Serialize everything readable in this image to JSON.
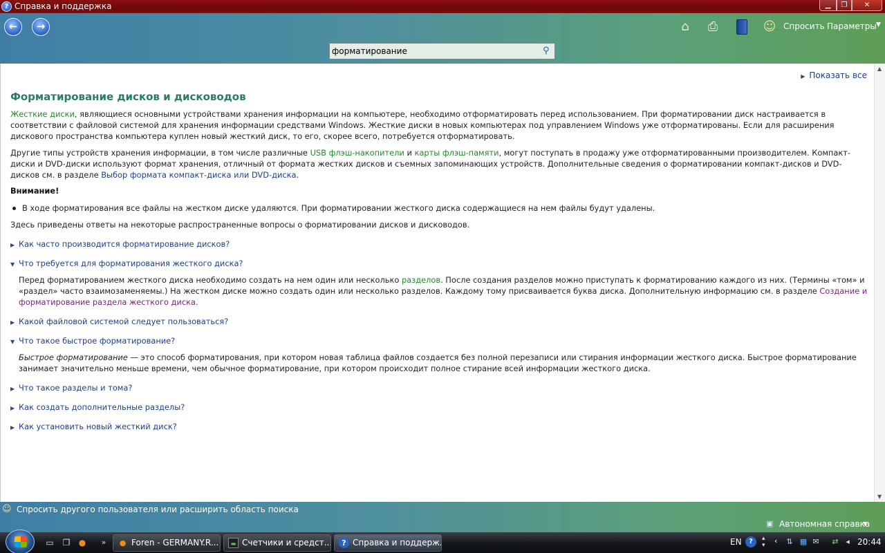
{
  "window": {
    "title": "Справка и поддержка",
    "buttons": {
      "minimize": "▁",
      "maximize": "❐",
      "close": "✕"
    }
  },
  "toolbar": {
    "back": "←",
    "forward": "→",
    "icons": [
      "home-icon",
      "print-icon",
      "book-icon",
      "people-icon"
    ],
    "ask": "Спросить",
    "options": "Параметры",
    "search_value": "форматирование"
  },
  "article": {
    "show_all": "Показать все",
    "title": "Форматирование дисков и дисководов",
    "p1": {
      "link": "Жесткие диски",
      "text": ", являющиеся основными устройствами хранения информации на компьютере, необходимо отформатировать перед использованием. При форматировании диск настраивается в соответствии с файловой системой для хранения информации средствами Windows. Жесткие диски в новых компьютерах под управлением Windows уже отформатированы. Если для расширения дискового пространства компьютера куплен новый жесткий диск, то его, скорее всего, потребуется отформатировать."
    },
    "p2": {
      "t1": "Другие типы устройств хранения информации, в том числе различные ",
      "link1": "USB флэш-накопители",
      "t2": " и ",
      "link2": "карты флэш-памяти",
      "t3": ", могут поступать в продажу уже отформатированными производителем. Компакт-диски и DVD-диски используют формат хранения, отличный от формата жестких дисков и съемных запоминающих устройств. Дополнительные сведения о форматировании компакт-дисков и DVD-дисков см. в разделе ",
      "link3": "Выбор формата компакт-диска или DVD-диска",
      "t4": "."
    },
    "warning_title": "Внимание!",
    "warning_text": "В ходе форматирования все файлы на жестком диске удаляются. При форматировании жесткого диска содержащиеся на нем файлы будут удалены.",
    "intro": "Здесь приведены ответы на некоторые распространенные вопросы о форматировании дисков и дисководов.",
    "questions": [
      {
        "label": "Как часто производится форматирование дисков?"
      },
      {
        "label": "Что требуется для форматирования жесткого диска?"
      },
      {
        "label": "Какой файловой системой следует пользоваться?"
      },
      {
        "label": "Что такое быстрое форматирование?"
      },
      {
        "label": "Что такое разделы и тома?"
      },
      {
        "label": "Как создать дополнительные разделы?"
      },
      {
        "label": "Как установить новый жесткий диск?"
      }
    ],
    "answer2": {
      "t1": "Перед форматированием жесткого диска необходимо создать на нем один или несколько ",
      "link1": "разделов",
      "t2": ". После создания разделов можно приступать к форматированию каждого из них. (Термины «том» и «раздел» часто взаимозаменяемы.) На жестком диске можно создать один или несколько разделов. Каждому тому присваивается буква диска. Дополнительную информацию см. в разделе ",
      "link2": "Создание и форматирование раздела жесткого диска",
      "t3": "."
    },
    "answer4": {
      "em": "Быстрое форматирование",
      "text": " — это способ форматирования, при котором новая таблица файлов создается без полной перезаписи или стирания информации жесткого диска. Быстрое форматирование занимает значительно меньше времени, чем обычное форматирование, при котором происходит полное стирание всей информации жесткого диска."
    }
  },
  "statusbar": {
    "ask_other": "Спросить другого пользователя или расширить область поиска",
    "offline": "Автономная справка"
  },
  "taskbar": {
    "tasks": [
      {
        "label": "Foren - GERMANY.R..."
      },
      {
        "label": "Счетчики и средст..."
      },
      {
        "label": "Справка и поддерж..."
      }
    ],
    "lang": "EN",
    "time": "20:44"
  }
}
